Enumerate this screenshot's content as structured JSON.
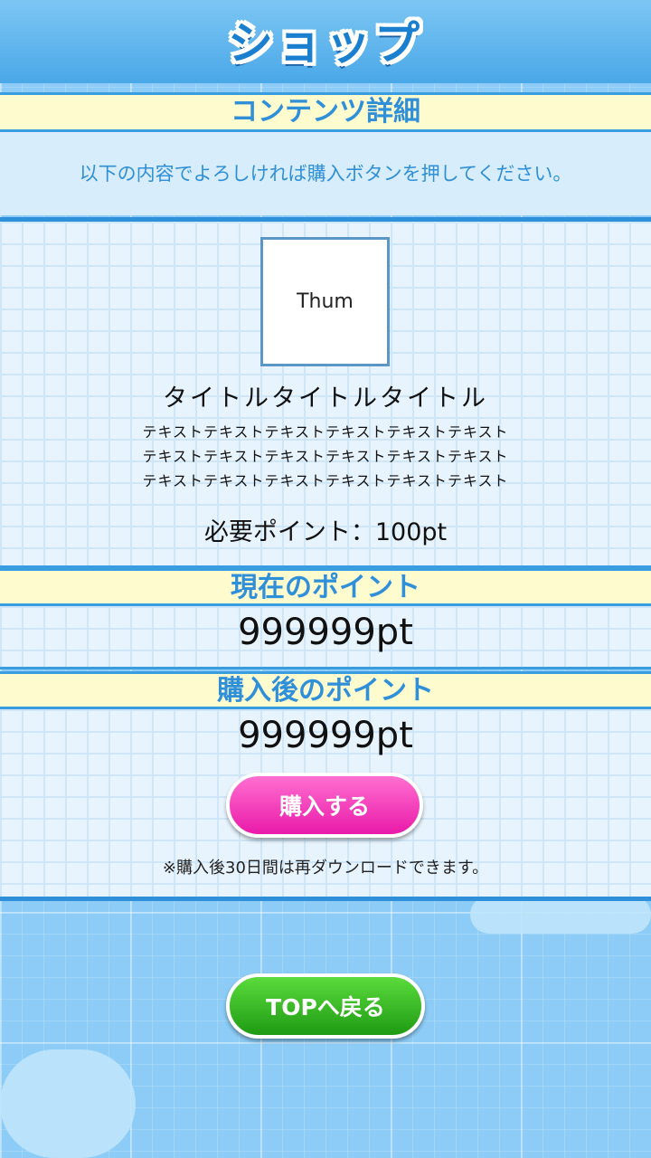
{
  "header": {
    "title": "ショップ"
  },
  "sections": {
    "content_detail": "コンテンツ詳細",
    "notice": "以下の内容でよろしければ購入ボタンを押してください。",
    "current_points_label": "現在のポイント",
    "after_points_label": "購入後のポイント"
  },
  "item": {
    "thumb_label": "Thum",
    "title": "タイトルタイトルタイトル",
    "text_lines": [
      "テキストテキストテキストテキストテキストテキスト",
      "テキストテキストテキストテキストテキストテキスト",
      "テキストテキストテキストテキストテキストテキスト"
    ],
    "required_points": "必要ポイント：100pt"
  },
  "points": {
    "current": "999999pt",
    "after": "999999pt"
  },
  "buttons": {
    "buy": "購入する",
    "top": "TOPへ戻る"
  },
  "footnote": "※購入後30日間は再ダウンロードできます。",
  "colors": {
    "accent_blue": "#2f8fd8",
    "buy_pink": "#e91aa9",
    "top_green": "#1f9b14",
    "bar_yellow": "#fefccf"
  }
}
